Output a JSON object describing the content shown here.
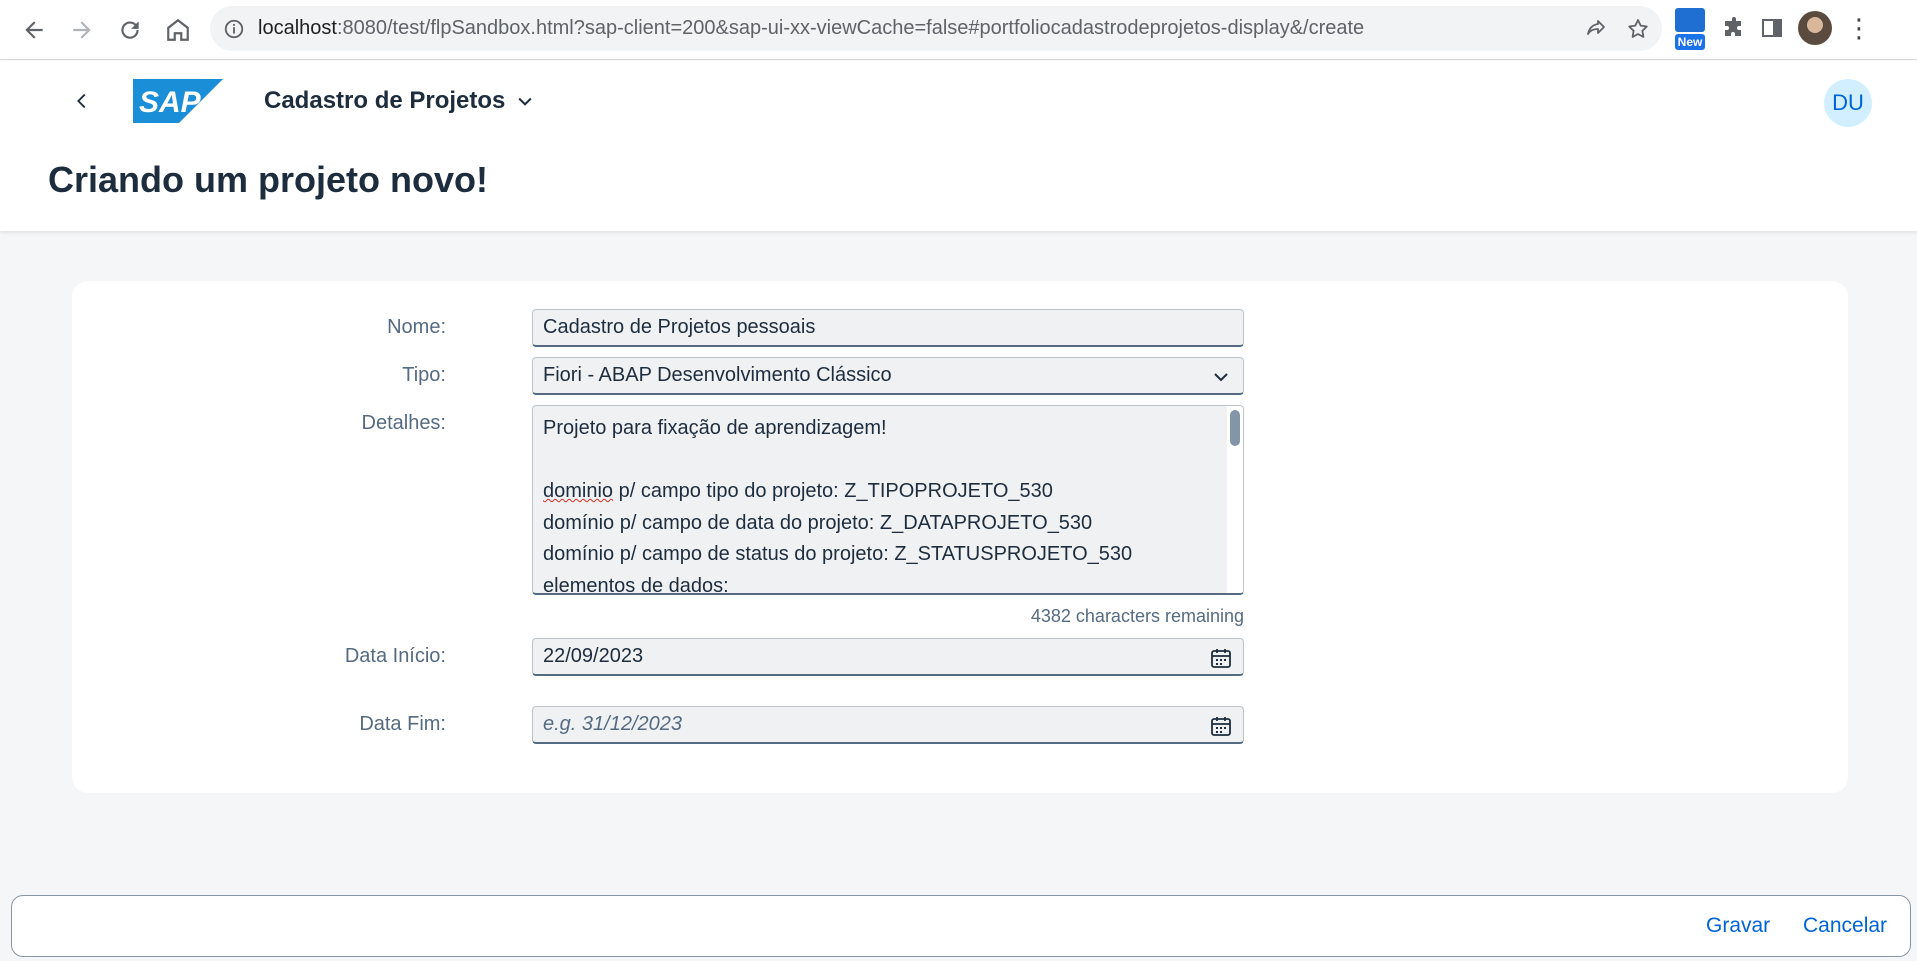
{
  "browser": {
    "url_host": "localhost",
    "url_rest": ":8080/test/flpSandbox.html?sap-client=200&sap-ui-xx-viewCache=false#portfoliocadastrodeprojetos-display&/create",
    "extension_badge": "New"
  },
  "shell": {
    "logo_text": "SAP",
    "app_title": "Cadastro de Projetos",
    "avatar_initials": "DU",
    "page_title": "Criando um projeto novo!"
  },
  "form": {
    "nome": {
      "label": "Nome:",
      "value": "Cadastro de Projetos pessoais"
    },
    "tipo": {
      "label": "Tipo:",
      "value": "Fiori - ABAP Desenvolvimento Clássico"
    },
    "detalhes": {
      "label": "Detalhes:",
      "lines": [
        "Projeto para fixação de aprendizagem!",
        "",
        "dominio p/ campo tipo do projeto: Z_TIPOPROJETO_530",
        "domínio p/ campo de data do projeto: Z_DATAPROJETO_530",
        "domínio p/ campo de status do projeto: Z_STATUSPROJETO_530",
        "elementos de dados:"
      ],
      "counter": "4382 characters remaining"
    },
    "data_inicio": {
      "label": "Data Início:",
      "value": "22/09/2023"
    },
    "data_fim": {
      "label": "Data Fim:",
      "value": "",
      "placeholder": "e.g. 31/12/2023"
    }
  },
  "footer": {
    "save_label": "Gravar",
    "cancel_label": "Cancelar"
  },
  "colors": {
    "brand_blue": "#0064d9",
    "sap_logo": "#1a8ed6"
  }
}
